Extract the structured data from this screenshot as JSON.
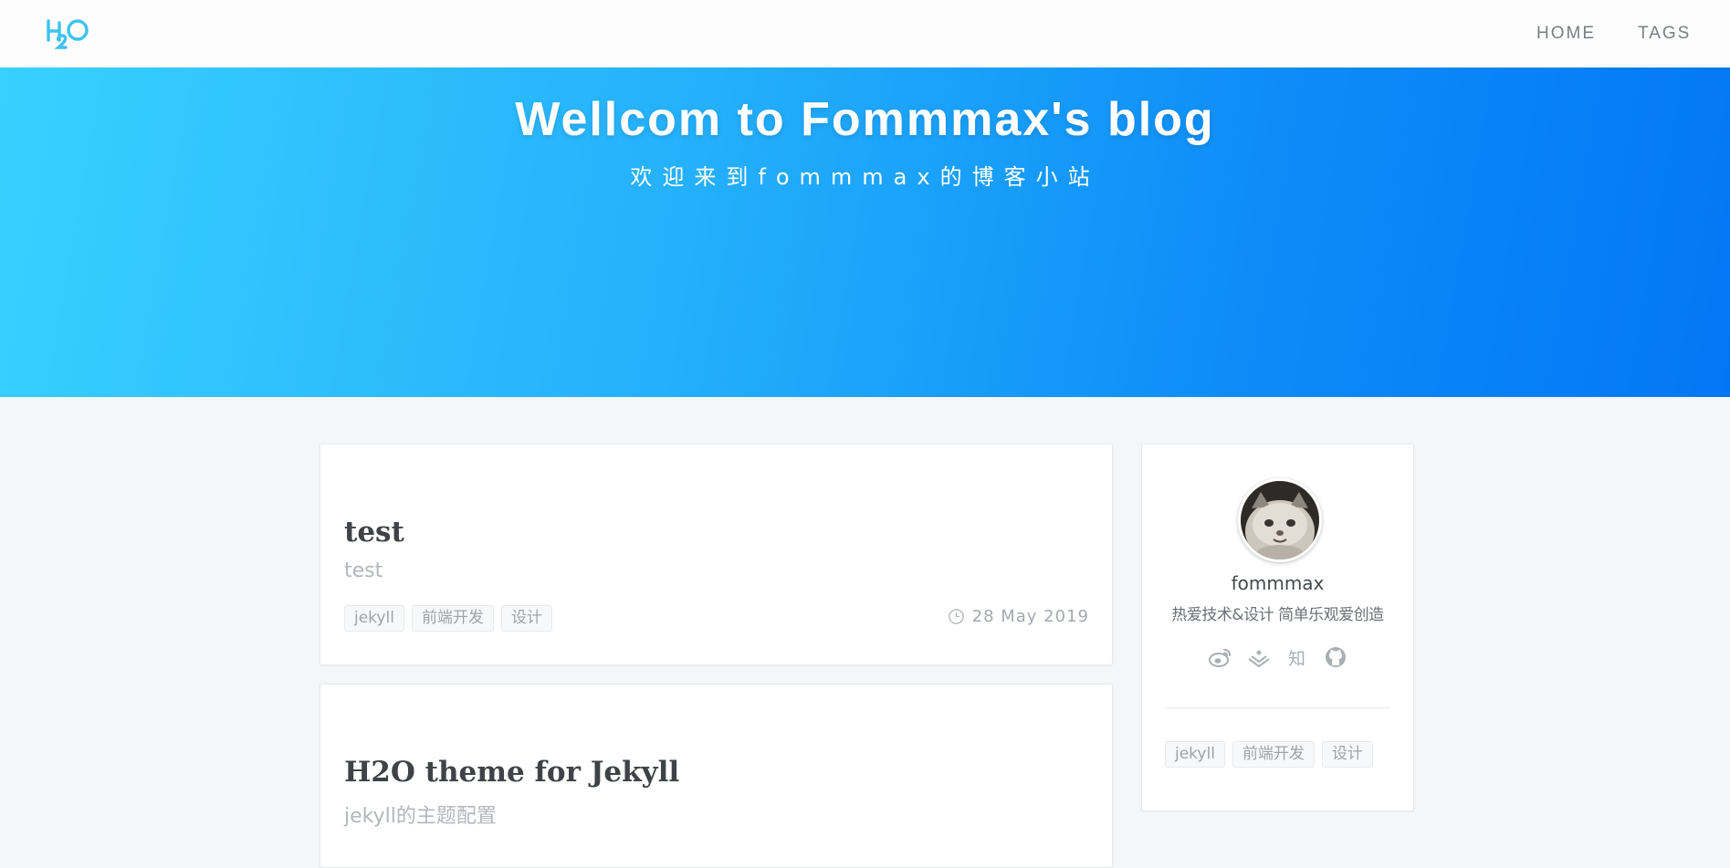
{
  "nav": {
    "logo_text": "H2O",
    "links": [
      {
        "label": "HOME"
      },
      {
        "label": "TAGS"
      }
    ]
  },
  "hero": {
    "title": "Wellcom to Fommmax's blog",
    "subtitle": "欢迎来到fommmax的博客小站",
    "gradient_colors": [
      "#39d0ff",
      "#0277f6"
    ]
  },
  "posts": [
    {
      "title": "test",
      "subtitle": "test",
      "tags": [
        "jekyll",
        "前端开发",
        "设计"
      ],
      "date": "28 May 2019"
    },
    {
      "title": "H2O theme for Jekyll",
      "subtitle": "jekyll的主题配置"
    }
  ],
  "sidebar": {
    "name": "fommmax",
    "bio": "热爱技术&设计 简单乐观爱创造",
    "socials": [
      {
        "icon": "weibo-icon"
      },
      {
        "icon": "juejin-icon"
      },
      {
        "icon": "zhihu-icon",
        "label": "知"
      },
      {
        "icon": "github-icon"
      }
    ],
    "tags": [
      "jekyll",
      "前端开发",
      "设计"
    ]
  },
  "colors": {
    "accent": "#1aa3f5",
    "logo": "#3ec3ee",
    "background": "#f5f6f8"
  }
}
